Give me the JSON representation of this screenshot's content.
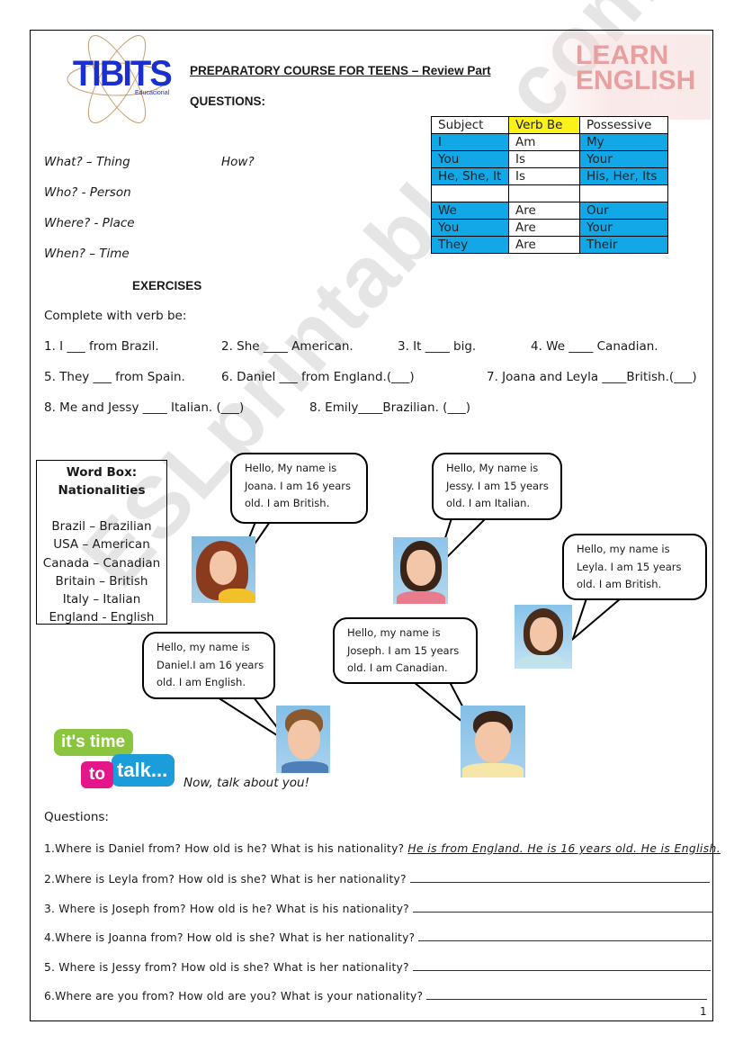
{
  "header": {
    "logo_text": "TIBITS",
    "logo_subtext": "Educacional",
    "title": "PREPARATORY COURSE FOR TEENS – Review Part",
    "questions_heading": "QUESTIONS:",
    "banner_line1": "LEARN",
    "banner_line2": "ENGLISH"
  },
  "question_words": [
    "What? – Thing",
    "Who? - Person",
    "Where? - Place",
    "When? – Time"
  ],
  "how_word": "How?",
  "grammar_table": {
    "headers": [
      "Subject",
      "Verb Be",
      "Possessive"
    ],
    "rows": [
      [
        "I",
        "Am",
        "My"
      ],
      [
        "You",
        "Is",
        "Your"
      ],
      [
        "He, She, It",
        "Is",
        "His, Her, Its"
      ],
      [
        "",
        "",
        ""
      ],
      [
        "We",
        "Are",
        "Our"
      ],
      [
        "You",
        "Are",
        "Your"
      ],
      [
        "They",
        "Are",
        "Their"
      ]
    ],
    "colors": {
      "highlight_blue": "#12a7e6",
      "highlight_yellow": "#fbf21a"
    }
  },
  "exercises": {
    "heading": "EXERCISES",
    "instruction": "Complete with verb be:",
    "items": [
      "1. I ___ from Brazil.",
      "2. She ____ American.",
      "3. It ____ big.",
      "4. We ____ Canadian.",
      "5. They ___ from Spain.",
      "6. Daniel ___ from England.(___)",
      "7. Joana and Leyla ____British.(___)",
      "8. Me and Jessy ____ Italian.  (___)",
      "8. Emily____Brazilian. (___)"
    ]
  },
  "word_box": {
    "title_line1": "Word Box:",
    "title_line2": "Nationalities",
    "items": [
      "Brazil – Brazilian",
      "USA – American",
      "Canada – Canadian",
      "Britain – British",
      "Italy – Italian",
      "England - English"
    ]
  },
  "speech_bubbles": [
    {
      "name": "Joana",
      "lines": [
        "Hello, My name is",
        "Joana. I am 16 years",
        "old. I am British."
      ]
    },
    {
      "name": "Jessy",
      "lines": [
        "Hello, My name is",
        "Jessy. I am 15 years",
        "old. I am Italian."
      ]
    },
    {
      "name": "Leyla",
      "lines": [
        "Hello, my name is",
        "Leyla. I am 15 years",
        "old. I am British."
      ]
    },
    {
      "name": "Joseph",
      "lines": [
        "Hello, my name is",
        "Joseph. I am 15 years",
        "old. I am  Canadian."
      ]
    },
    {
      "name": "Daniel",
      "lines": [
        "Hello, my name is",
        "Daniel.I am 16 years",
        "old. I am English."
      ]
    }
  ],
  "talk": {
    "logo_word1": "it's time",
    "logo_word2": "to",
    "logo_word3": "talk...",
    "prompt": "Now, talk about you!"
  },
  "questions": {
    "heading": "Questions:",
    "items": [
      {
        "q": "1.Where is Daniel from? How old is he? What is his nationality?",
        "answer": "He is from England. He is 16 years old. He is English."
      },
      {
        "q": "2.Where is Leyla from? How old is she? What is her nationality?",
        "answer": ""
      },
      {
        "q": "3.  Where is Joseph from? How old is he? What is his nationality?",
        "answer": ""
      },
      {
        "q": "4.Where is Joanna from? How old is she? What is her nationality?",
        "answer": ""
      },
      {
        "q": "5.  Where is Jessy from? How old is she? What is her nationality?",
        "answer": ""
      },
      {
        "q": "6.Where are you from? How old are you? What is your nationality?",
        "answer": ""
      }
    ]
  },
  "watermark": "ESLprintables.com",
  "page_number": "1"
}
